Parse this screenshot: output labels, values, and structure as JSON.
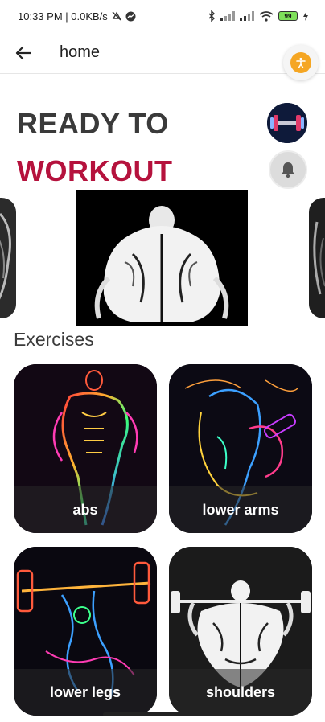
{
  "status_bar": {
    "time_info": "10:33 PM | 0.0KB/s",
    "battery": "99"
  },
  "app_bar": {
    "title": "home"
  },
  "hero": {
    "line1": "READY TO",
    "line2": "WORKOUT"
  },
  "exercises": {
    "title": "Exercises",
    "items": [
      {
        "label": "abs"
      },
      {
        "label": "lower arms"
      },
      {
        "label": "lower legs"
      },
      {
        "label": "shoulders"
      }
    ]
  },
  "colors": {
    "accent": "#b5123d",
    "heading": "#3a3a3a",
    "access_button": "#f5a623"
  },
  "icons": [
    "arrow-back-icon",
    "accessibility-icon",
    "bell-icon",
    "wifi-icon",
    "signal-icon",
    "bluetooth-icon",
    "battery-icon"
  ]
}
